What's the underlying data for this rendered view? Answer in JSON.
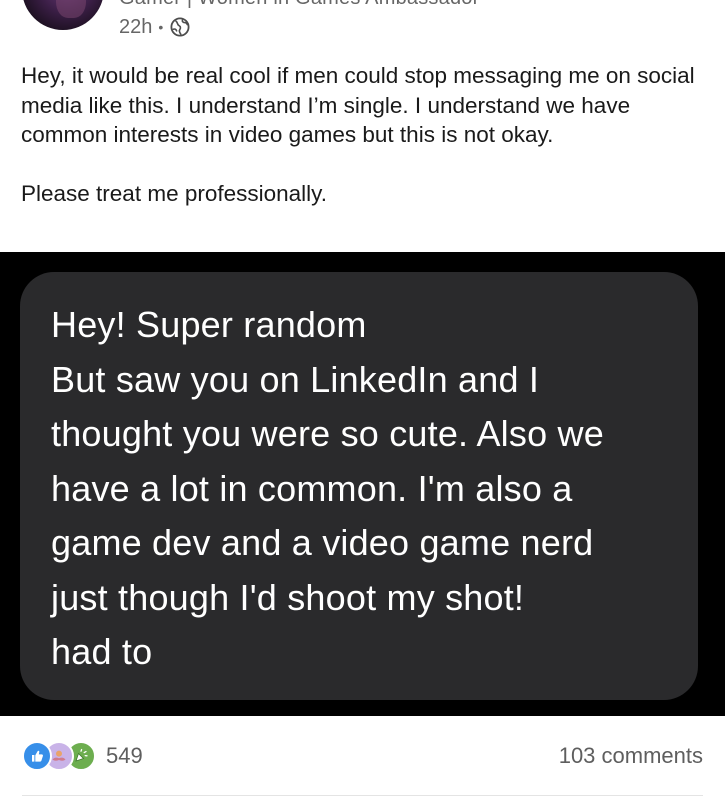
{
  "author": {
    "headline": "Gamer | Women in Games Ambassador",
    "time": "22h",
    "separator": "•",
    "visibility_icon": "globe-icon"
  },
  "post": {
    "paragraphs": [
      "Hey, it would be real cool if men could stop messaging me on social media like this. I understand I’m single. I understand we have common interests in video games but this is not okay.",
      "Please treat me professionally."
    ]
  },
  "image": {
    "message_lines": [
      "Hey! Super random",
      "But saw you on LinkedIn and I",
      "thought you were so cute. Also we",
      "have a lot in common. I'm also a",
      "game dev and a video game nerd",
      "just though I'd shoot my shot!",
      "had to"
    ]
  },
  "social": {
    "reaction_icons": [
      "like-icon",
      "support-icon",
      "celebrate-icon"
    ],
    "reaction_count": "549",
    "comments": "103 comments"
  },
  "colors": {
    "like": "#378fe9",
    "support": "#c9b3e8",
    "celebrate": "#6dae4f",
    "bubble": "#2a2a2c",
    "media_background": "#000000"
  }
}
